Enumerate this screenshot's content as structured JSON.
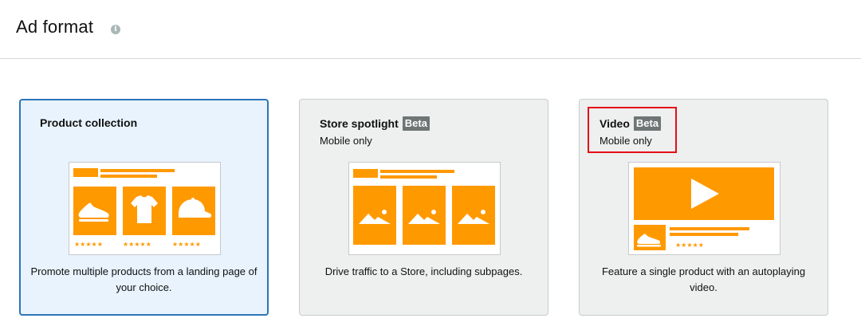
{
  "page": {
    "title": "Ad format"
  },
  "cards": [
    {
      "title": "Product collection",
      "badge": "",
      "subtitle": "",
      "description": "Promote multiple products from a landing page of your choice.",
      "selected": true,
      "icons": [
        "shoe-icon",
        "tshirt-icon",
        "cap-icon"
      ]
    },
    {
      "title": "Store spotlight",
      "badge": "Beta",
      "subtitle": "Mobile only",
      "description": "Drive traffic to a Store, including subpages.",
      "selected": false,
      "icons": [
        "image-icon",
        "image-icon",
        "image-icon"
      ]
    },
    {
      "title": "Video",
      "badge": "Beta",
      "subtitle": "Mobile only",
      "description": "Feature a single product with an autoplaying video.",
      "selected": false,
      "icons": [
        "play-icon",
        "shoe-icon"
      ]
    }
  ],
  "colors": {
    "accent_orange": "#ff9900",
    "selected_border": "#2c75b6",
    "selected_bg": "#e8f3fd",
    "card_bg": "#eeefef",
    "badge_bg": "#6e7575",
    "highlight_red": "#e30e16"
  }
}
